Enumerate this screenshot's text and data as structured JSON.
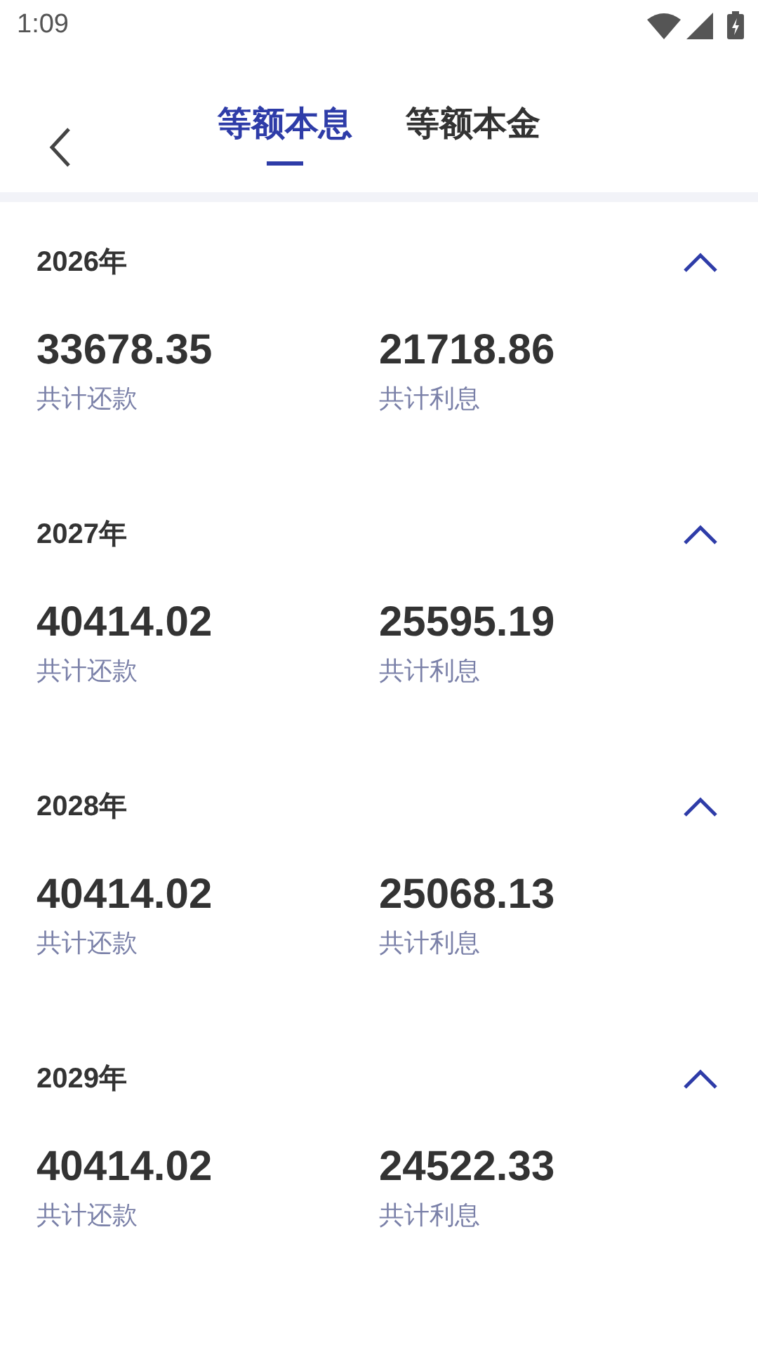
{
  "status_bar": {
    "time": "1:09"
  },
  "tabs": [
    {
      "label": "等额本息",
      "selected": true
    },
    {
      "label": "等额本金",
      "selected": false
    }
  ],
  "years": [
    {
      "year": "2026年",
      "expanded": true,
      "total_payment": "33678.35",
      "total_payment_label": "共计还款",
      "total_interest": "21718.86",
      "total_interest_label": "共计利息"
    },
    {
      "year": "2027年",
      "expanded": true,
      "total_payment": "40414.02",
      "total_payment_label": "共计还款",
      "total_interest": "25595.19",
      "total_interest_label": "共计利息"
    },
    {
      "year": "2028年",
      "expanded": true,
      "total_payment": "40414.02",
      "total_payment_label": "共计还款",
      "total_interest": "25068.13",
      "total_interest_label": "共计利息"
    },
    {
      "year": "2029年",
      "expanded": true,
      "total_payment": "40414.02",
      "total_payment_label": "共计还款",
      "total_interest": "24522.33",
      "total_interest_label": "共计利息"
    }
  ]
}
